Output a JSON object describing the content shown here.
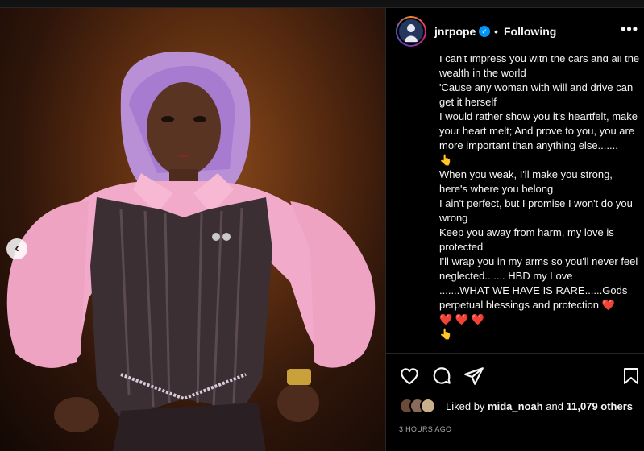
{
  "post": {
    "nav_prev": "‹",
    "header": {
      "username": "jnrpope",
      "verified_icon": "verified-badge-icon",
      "separator": "•",
      "follow_status": "Following",
      "more": "•••"
    },
    "caption_lines": [
      "I can't impress you with the cars and all the wealth in the world",
      "'Cause any woman with will and drive can get it herself",
      "I would rather show you it's heartfelt, make your heart melt; And prove to you, you are more important than anything else.......",
      "👆",
      "When you weak, I'll make you strong, here's where you belong",
      "I ain't perfect, but I promise I won't do you wrong",
      "Keep you away from harm, my love is protected",
      "I'll wrap you in my arms so you'll never feel neglected....... HBD my Love",
      ".......WHAT WE HAVE IS RARE......Gods perpetual blessings and protection ❤️",
      "❤️ ❤️ ❤️",
      "👆"
    ],
    "likes": {
      "prefix": "Liked by",
      "user": "mida_noah",
      "joiner": "and",
      "count": "11,079 others"
    },
    "timestamp": "3 HOURS AGO"
  }
}
